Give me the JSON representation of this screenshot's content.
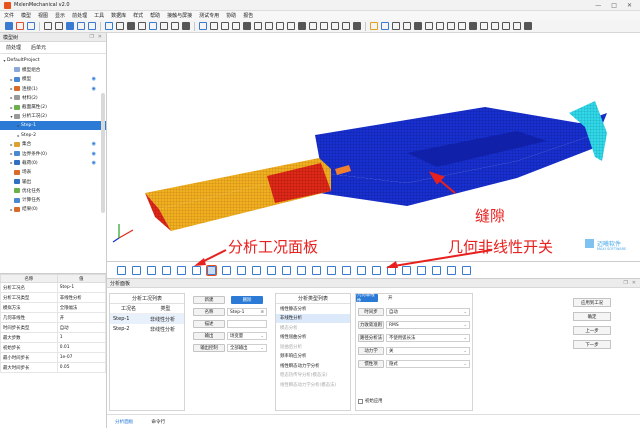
{
  "window": {
    "title": "MxlenMechanical v2.0",
    "controls": [
      "—",
      "□",
      "✕"
    ]
  },
  "menu": [
    "文件",
    "模型",
    "视图",
    "显示",
    "前处理",
    "工具",
    "数据库",
    "样式",
    "帮助",
    "接触与屏接",
    "测试专用",
    "协助",
    "报告"
  ],
  "left_panel": {
    "title": "模型树",
    "tabs": [
      "前处理",
      "后单元"
    ],
    "tree": [
      {
        "label": "DefaultProject",
        "indent": 0,
        "toggle": "▾",
        "icon": "",
        "eye": false,
        "selected": false
      },
      {
        "label": "模型组合",
        "indent": 1,
        "toggle": "",
        "icon": "#8aa8d8",
        "eye": false,
        "selected": false
      },
      {
        "label": "模型",
        "indent": 1,
        "toggle": "▸",
        "icon": "#4a88d0",
        "eye": true,
        "selected": false
      },
      {
        "label": "连接(1)",
        "indent": 1,
        "toggle": "▸",
        "icon": "#d86a2a",
        "eye": true,
        "selected": false
      },
      {
        "label": "材料(2)",
        "indent": 1,
        "toggle": "▸",
        "icon": "#999999",
        "eye": false,
        "selected": false
      },
      {
        "label": "截面属性(2)",
        "indent": 1,
        "toggle": "▸",
        "icon": "#6ab04c",
        "eye": false,
        "selected": false
      },
      {
        "label": "分析工况(2)",
        "indent": 1,
        "toggle": "▾",
        "icon": "#999999",
        "eye": false,
        "selected": false
      },
      {
        "label": "Step-1",
        "indent": 2,
        "toggle": "▸",
        "icon": "",
        "eye": false,
        "selected": true
      },
      {
        "label": "Step-2",
        "indent": 2,
        "toggle": "▸",
        "icon": "",
        "eye": false,
        "selected": false
      },
      {
        "label": "集合",
        "indent": 1,
        "toggle": "▸",
        "icon": "#e0a030",
        "eye": true,
        "selected": false
      },
      {
        "label": "边界条件(0)",
        "indent": 1,
        "toggle": "▸",
        "icon": "#4a88d0",
        "eye": true,
        "selected": false
      },
      {
        "label": "载荷(0)",
        "indent": 1,
        "toggle": "▸",
        "icon": "#3070c0",
        "eye": true,
        "selected": false
      },
      {
        "label": "场表",
        "indent": 1,
        "toggle": "",
        "icon": "#d86a2a",
        "eye": false,
        "selected": false
      },
      {
        "label": "输出",
        "indent": 1,
        "toggle": "",
        "icon": "#3070c0",
        "eye": false,
        "selected": false
      },
      {
        "label": "优化任务",
        "indent": 1,
        "toggle": "",
        "icon": "#6ab04c",
        "eye": false,
        "selected": false
      },
      {
        "label": "计算任务",
        "indent": 1,
        "toggle": "",
        "icon": "#4a88d0",
        "eye": false,
        "selected": false
      },
      {
        "label": "结果(0)",
        "indent": 1,
        "toggle": "▸",
        "icon": "#d86a2a",
        "eye": false,
        "selected": false
      }
    ]
  },
  "properties": {
    "headers": [
      "名称",
      "值"
    ],
    "rows": [
      [
        "分析工况名",
        "Step-1"
      ],
      [
        "分析工况类型",
        "非线性分析"
      ],
      [
        "模拟方法",
        "全限幅法"
      ],
      [
        "几何非线性",
        "开"
      ],
      [
        "时间步长类型",
        "自动"
      ],
      [
        "最大步数",
        "1"
      ],
      [
        "初始步长",
        "0.01"
      ],
      [
        "最小时间步长",
        "1e-07"
      ],
      [
        "最大时间步长",
        "0.05"
      ]
    ]
  },
  "bottom": {
    "title": "分析面板",
    "case_list": {
      "header": "分析工况列表",
      "columns": [
        "工况名",
        "类型"
      ],
      "rows": [
        [
          "Step-1",
          "非线性分析"
        ],
        [
          "Step-2",
          "非线性分析"
        ]
      ]
    },
    "form": {
      "buttons": [
        "新建",
        "删除"
      ],
      "name_label": "名称",
      "name_value": "Step-1",
      "desc_label": "描述",
      "desc_value": "",
      "output_label": "输出",
      "output_value": "场变量",
      "output_ctrl_label": "输出控制",
      "output_ctrl_value": "全部输出"
    },
    "type_list": {
      "header": "分析类型列表",
      "items": [
        {
          "label": "线性静态分析",
          "state": "normal"
        },
        {
          "label": "非线性分析",
          "state": "selected"
        },
        {
          "label": "模态分析",
          "state": "dim"
        },
        {
          "label": "线性屈曲分析",
          "state": "normal"
        },
        {
          "label": "屈曲后分析",
          "state": "dim"
        },
        {
          "label": "频率响应分析",
          "state": "normal"
        },
        {
          "label": "线性瞬态动力学分析",
          "state": "normal"
        },
        {
          "label": "稳态热传导分析(模态法)",
          "state": "dim"
        },
        {
          "label": "线性瞬态动力学分析(模态法)",
          "state": "dim"
        }
      ]
    },
    "params": {
      "tab": "几何非线性",
      "tab_value": "开",
      "rows": [
        {
          "label": "时间步",
          "value": "自动"
        },
        {
          "label": "力收敛准则",
          "value": "RMS"
        },
        {
          "label": "路径分析法",
          "value": "不使用弧长法"
        },
        {
          "label": "动力学",
          "value": "关"
        },
        {
          "label": "惯性项",
          "value": "隐式"
        }
      ],
      "checkbox_label": "初始应用"
    },
    "side_buttons": [
      "应用到工况",
      "确定",
      "上一步",
      "下一步"
    ],
    "bottom_tabs": [
      "分析面板",
      "命令行"
    ]
  },
  "annotations": {
    "gap": "缝隙",
    "analysis_panel": "分析工况面板",
    "geo_nonlinear": "几何非线性开关"
  },
  "watermark": {
    "cn": "迈曦软件",
    "en": "MAXI SOFTWARE"
  },
  "colors": {
    "accent": "#2a7ad6",
    "annotation": "#e8201e",
    "mesh_blue": "#1428c8",
    "mesh_yellow": "#f0b020",
    "mesh_red": "#e02818",
    "mesh_cyan": "#30d8e8"
  }
}
